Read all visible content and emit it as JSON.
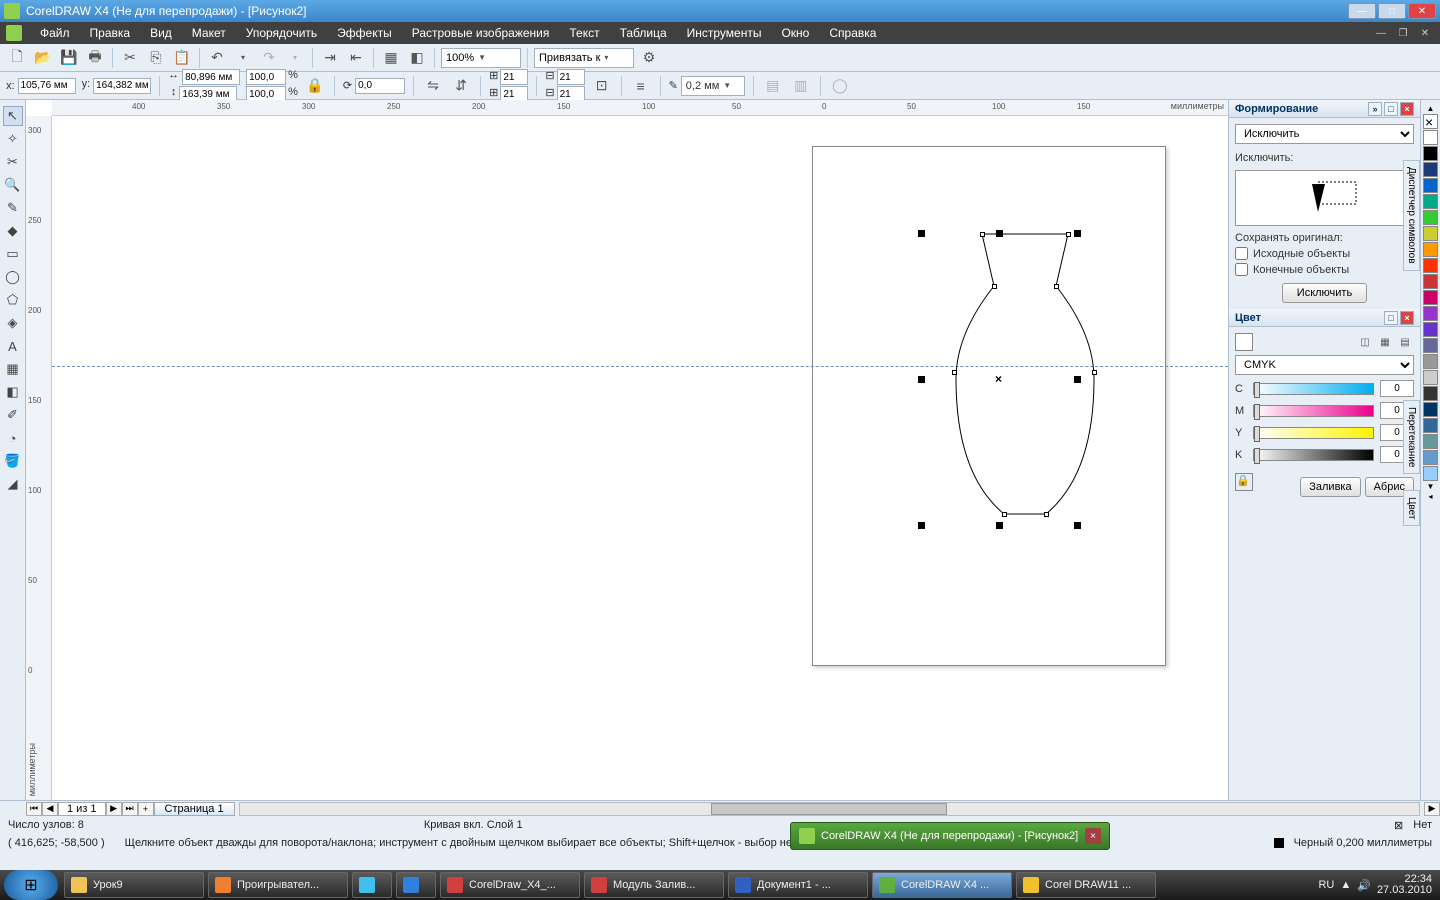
{
  "window": {
    "title": "CorelDRAW X4 (Не для перепродажи) - [Рисунок2]"
  },
  "menu": [
    "Файл",
    "Правка",
    "Вид",
    "Макет",
    "Упорядочить",
    "Эффекты",
    "Растровые изображения",
    "Текст",
    "Таблица",
    "Инструменты",
    "Окно",
    "Справка"
  ],
  "toolbar": {
    "zoom": "100%",
    "snap_label": "Привязать к"
  },
  "props": {
    "x_label": "x:",
    "x": "105,76 мм",
    "y_label": "y:",
    "y": "164,382 мм",
    "w": "80,896 мм",
    "h": "163,39 мм",
    "sx": "100,0",
    "sy": "100,0",
    "pct": "%",
    "rot": "0,0",
    "nx": "21",
    "ny": "21",
    "outline": "0,2 мм"
  },
  "ruler_units": "миллиметры",
  "ruler_h": [
    "400",
    "350",
    "300",
    "250",
    "200",
    "150",
    "100",
    "50",
    "0",
    "50",
    "100",
    "150"
  ],
  "ruler_v": [
    "300",
    "250",
    "200",
    "150",
    "100",
    "50",
    "0"
  ],
  "docker_shaping": {
    "title": "Формирование",
    "op": "Исключить",
    "op_label": "Исключить:",
    "keep_label": "Сохранять оригинал:",
    "chk_source": "Исходные объекты",
    "chk_target": "Конечные объекты",
    "apply": "Исключить"
  },
  "docker_color": {
    "title": "Цвет",
    "model": "CMYK",
    "channels": [
      {
        "lbl": "C",
        "val": "0",
        "grad": "linear-gradient(90deg,#fff,#00aeef)"
      },
      {
        "lbl": "M",
        "val": "0",
        "grad": "linear-gradient(90deg,#fff,#ec008c)"
      },
      {
        "lbl": "Y",
        "val": "0",
        "grad": "linear-gradient(90deg,#fff,#fff200)"
      },
      {
        "lbl": "K",
        "val": "0",
        "grad": "linear-gradient(90deg,#fff,#000)"
      }
    ],
    "fill_btn": "Заливка",
    "outline_btn": "Абрис"
  },
  "side_tabs": [
    "Диспетчер символов",
    "Перетекание",
    "Цвет"
  ],
  "palette": [
    "#ffffff",
    "#000000",
    "#1a3a7a",
    "#0066cc",
    "#00aa88",
    "#33cc33",
    "#cccc33",
    "#ff9900",
    "#ff3300",
    "#cc3333",
    "#cc0066",
    "#9933cc",
    "#6633cc",
    "#666699",
    "#999999",
    "#cccccc",
    "#333333",
    "#003366",
    "#336699",
    "#669999",
    "#6699cc",
    "#99ccff"
  ],
  "pagebar": {
    "counter": "1 из 1",
    "tab": "Страница 1"
  },
  "status": {
    "nodes": "Число узлов: 8",
    "layer": "Кривая вкл. Слой 1",
    "coords": "( 416,625; -58,500 )",
    "hint": "Щелкните объект дважды для поворота/наклона; инструмент с двойным щелчком выбирает все объекты; Shift+щелчок - выбор неск",
    "fill_none": "Нет",
    "outline_info": "Черный  0,200 миллиметры"
  },
  "toast": "CorelDRAW X4 (Не для перепродажи) - [Рисунок2]",
  "task": [
    {
      "label": "Урок9",
      "c": "#f0c454"
    },
    {
      "label": "Проигрывател...",
      "c": "#f08030"
    },
    {
      "label": "",
      "c": "#40c0f0",
      "w": 40
    },
    {
      "label": "",
      "c": "#3080e0",
      "w": 40
    },
    {
      "label": "CorelDraw_X4_...",
      "c": "#d04040"
    },
    {
      "label": "Модуль Залив...",
      "c": "#d04040"
    },
    {
      "label": "Документ1 - ...",
      "c": "#3060c0"
    },
    {
      "label": "CorelDRAW X4 ...",
      "c": "#60b040",
      "active": true
    },
    {
      "label": "Corel DRAW11 ...",
      "c": "#f0c030"
    }
  ],
  "tray": {
    "lang": "RU",
    "time": "22:34",
    "date": "27.03.2010"
  }
}
